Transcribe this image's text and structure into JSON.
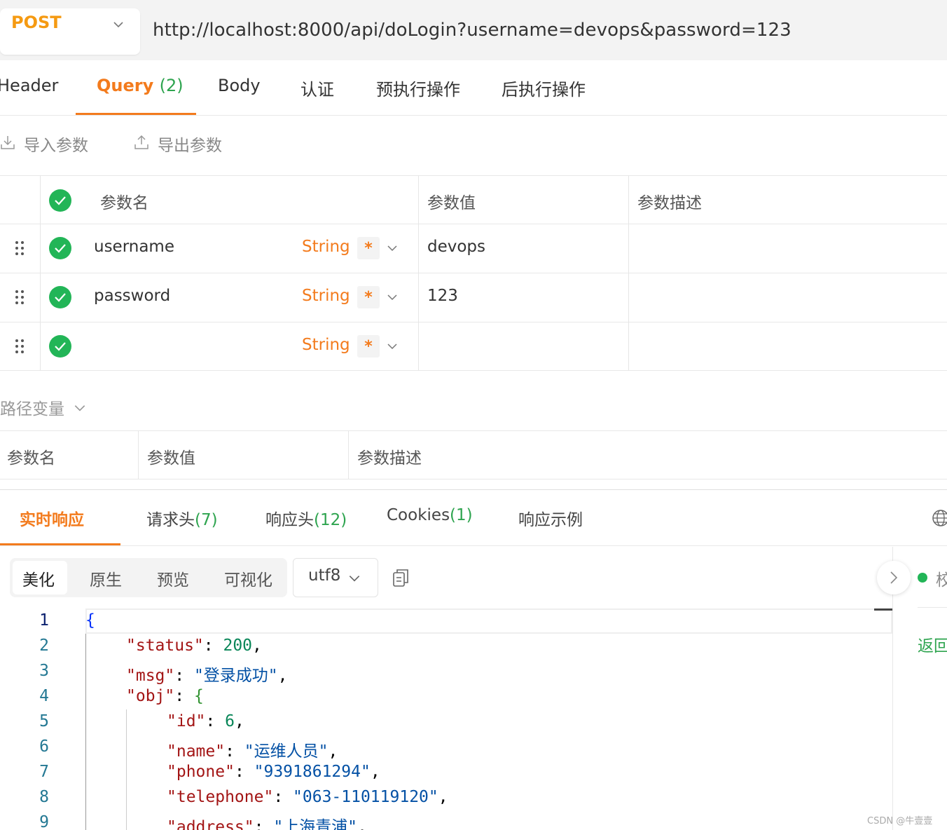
{
  "request": {
    "method": "POST",
    "url": "http://localhost:8000/api/doLogin?username=devops&password=123"
  },
  "request_tabs": [
    {
      "label": "Header",
      "count": ""
    },
    {
      "label": "Query",
      "count": "(2)"
    },
    {
      "label": "Body",
      "count": ""
    },
    {
      "label": "认证",
      "count": ""
    },
    {
      "label": "预执行操作",
      "count": ""
    },
    {
      "label": "后执行操作",
      "count": ""
    }
  ],
  "toolbar": {
    "import_label": "导入参数",
    "export_label": "导出参数"
  },
  "query_table": {
    "headers": {
      "name": "参数名",
      "value": "参数值",
      "desc": "参数描述"
    },
    "rows": [
      {
        "name": "username",
        "type": "String",
        "required": "*",
        "value": "devops",
        "desc": ""
      },
      {
        "name": "password",
        "type": "String",
        "required": "*",
        "value": "123",
        "desc": ""
      },
      {
        "name": "",
        "type": "String",
        "required": "*",
        "value": "",
        "desc": ""
      }
    ]
  },
  "path_vars": {
    "title": "路径变量",
    "headers": {
      "name": "参数名",
      "value": "参数值",
      "desc": "参数描述"
    }
  },
  "response_tabs": [
    {
      "label": "实时响应",
      "count": ""
    },
    {
      "label": "请求头",
      "count": "(7)"
    },
    {
      "label": "响应头",
      "count": "(12)"
    },
    {
      "label": "Cookies",
      "count": "(1)"
    },
    {
      "label": "响应示例",
      "count": ""
    }
  ],
  "view_modes": [
    "美化",
    "原生",
    "预览",
    "可视化"
  ],
  "encoding": "utf8",
  "side_panel": {
    "status_text": "校",
    "return_text": "返回"
  },
  "code_lines": [
    "1",
    "2",
    "3",
    "4",
    "5",
    "6",
    "7",
    "8",
    "9"
  ],
  "response_json": {
    "status_key": "\"status\"",
    "status_val": "200",
    "msg_key": "\"msg\"",
    "msg_val": "\"登录成功\"",
    "obj_key": "\"obj\"",
    "id_key": "\"id\"",
    "id_val": "6",
    "name_key": "\"name\"",
    "name_val": "\"运维人员\"",
    "phone_key": "\"phone\"",
    "phone_val": "\"9391861294\"",
    "telephone_key": "\"telephone\"",
    "telephone_val": "\"063-110119120\"",
    "address_key": "\"address\"",
    "address_val": "\"上海青浦\""
  },
  "watermark": "CSDN @牛壹壹",
  "colors": {
    "accent": "#f37b1d",
    "method": "#f59a12",
    "success": "#22b557",
    "count": "#2ea44f"
  }
}
